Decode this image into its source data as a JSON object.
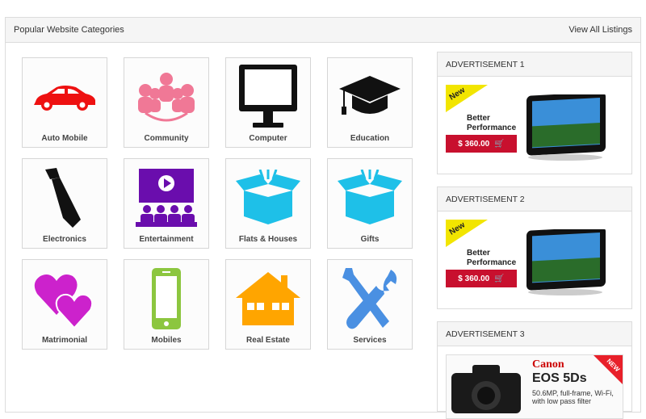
{
  "header": {
    "title": "Popular Website Categories",
    "view_all": "View All Listings"
  },
  "categories": [
    {
      "label": "Auto Mobile",
      "icon": "car-icon",
      "color": "#ee1111"
    },
    {
      "label": "Community",
      "icon": "community-icon",
      "color": "#f07896"
    },
    {
      "label": "Computer",
      "icon": "monitor-icon",
      "color": "#111111"
    },
    {
      "label": "Education",
      "icon": "graduation-cap-icon",
      "color": "#111111"
    },
    {
      "label": "Electronics",
      "icon": "tie-icon",
      "color": "#111111"
    },
    {
      "label": "Entertainment",
      "icon": "video-audience-icon",
      "color": "#6a0dad"
    },
    {
      "label": "Flats & Houses",
      "icon": "open-box-icon",
      "color": "#1ec0e8"
    },
    {
      "label": "Gifts",
      "icon": "open-box-icon",
      "color": "#1ec0e8"
    },
    {
      "label": "Matrimonial",
      "icon": "hearts-icon",
      "color": "#cc22cc"
    },
    {
      "label": "Mobiles",
      "icon": "mobile-phone-icon",
      "color": "#8cc63f"
    },
    {
      "label": "Real Estate",
      "icon": "house-icon",
      "color": "#ffa500"
    },
    {
      "label": "Services",
      "icon": "tools-icon",
      "color": "#4a90e2"
    }
  ],
  "ads": [
    {
      "title": "ADVERTISEMENT 1",
      "ribbon": "New",
      "tagline_1": "Better",
      "tagline_2": "Performance",
      "price": "$ 360.00"
    },
    {
      "title": "ADVERTISEMENT 2",
      "ribbon": "New",
      "tagline_1": "Better",
      "tagline_2": "Performance",
      "price": "$ 360.00"
    },
    {
      "title": "ADVERTISEMENT 3",
      "brand": "Canon",
      "model": "EOS 5Ds",
      "description": "50.6MP, full-frame, Wi-Fi, with low pass filter",
      "ribbon": "NEW"
    }
  ]
}
